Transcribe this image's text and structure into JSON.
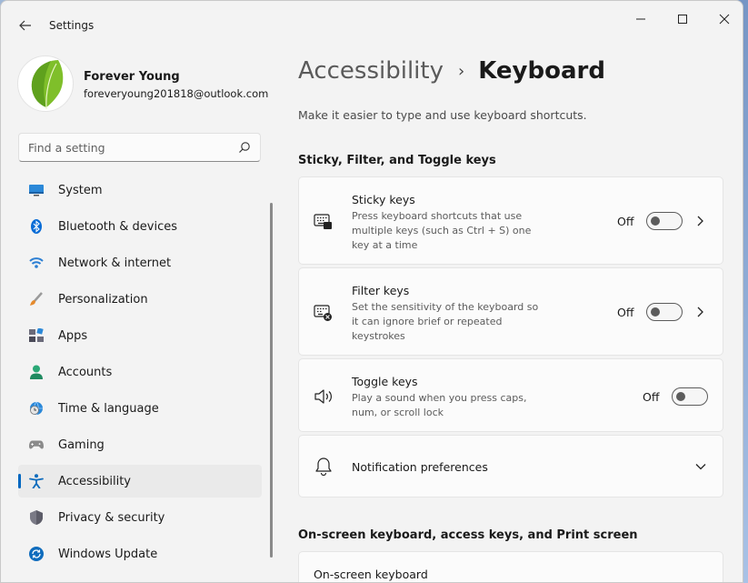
{
  "app": {
    "title": "Settings"
  },
  "user": {
    "name": "Forever Young",
    "email": "foreveryoung201818@outlook.com"
  },
  "search": {
    "placeholder": "Find a setting"
  },
  "sidebar": {
    "items": [
      {
        "label": "System",
        "icon": "monitor-icon"
      },
      {
        "label": "Bluetooth & devices",
        "icon": "bluetooth-icon"
      },
      {
        "label": "Network & internet",
        "icon": "wifi-icon"
      },
      {
        "label": "Personalization",
        "icon": "brush-icon"
      },
      {
        "label": "Apps",
        "icon": "apps-icon"
      },
      {
        "label": "Accounts",
        "icon": "person-icon"
      },
      {
        "label": "Time & language",
        "icon": "globe-clock-icon"
      },
      {
        "label": "Gaming",
        "icon": "gamepad-icon"
      },
      {
        "label": "Accessibility",
        "icon": "accessibility-icon",
        "active": true
      },
      {
        "label": "Privacy & security",
        "icon": "shield-icon"
      },
      {
        "label": "Windows Update",
        "icon": "update-icon"
      }
    ]
  },
  "main": {
    "breadcrumb_parent": "Accessibility",
    "breadcrumb_separator": "›",
    "page_title": "Keyboard",
    "description": "Make it easier to type and use keyboard shortcuts.",
    "section1_title": "Sticky, Filter, and Toggle keys",
    "cards": [
      {
        "title": "Sticky keys",
        "description": "Press keyboard shortcuts that use multiple keys (such as Ctrl + S) one key at a time",
        "state": "Off",
        "icon": "keyboard-sticky-icon"
      },
      {
        "title": "Filter keys",
        "description": "Set the sensitivity of the keyboard so it can ignore brief or repeated keystrokes",
        "state": "Off",
        "icon": "keyboard-filter-icon"
      },
      {
        "title": "Toggle keys",
        "description": "Play a sound when you press caps, num, or scroll lock",
        "state": "Off",
        "icon": "speaker-icon"
      },
      {
        "title": "Notification preferences",
        "icon": "bell-icon"
      }
    ],
    "section2_title": "On-screen keyboard, access keys, and Print screen",
    "osk_title": "On-screen keyboard"
  },
  "colors": {
    "accent": "#0067c0",
    "background": "#f3f3f3",
    "card": "#fbfbfb"
  }
}
